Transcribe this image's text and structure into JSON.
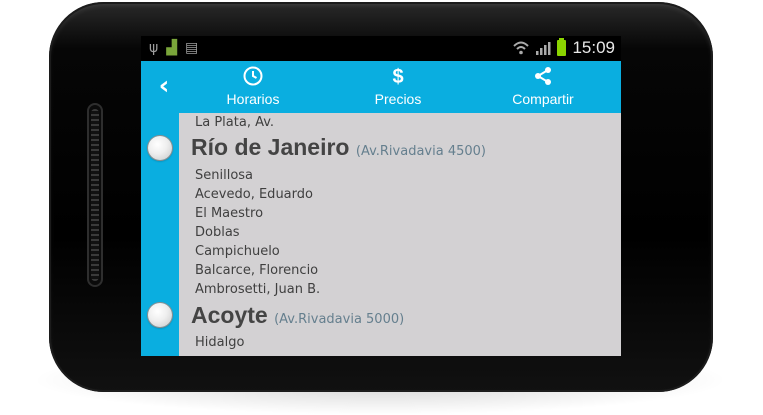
{
  "status_bar": {
    "icons_left": [
      "usb-icon",
      "android-icon",
      "sd-card-icon"
    ],
    "icons_right": [
      "wifi-icon",
      "signal-icon",
      "battery-icon"
    ],
    "time": "15:09",
    "battery_color": "#8bd400"
  },
  "toolbar": {
    "back_icon": "chevron-left-icon",
    "buttons": [
      {
        "label": "Horarios",
        "icon": "clock-icon",
        "glyph": "◷"
      },
      {
        "label": "Precios",
        "icon": "dollar-icon",
        "glyph": "$"
      },
      {
        "label": "Compartir",
        "icon": "share-icon",
        "glyph": "<"
      }
    ],
    "color": "#0aaee0"
  },
  "list": {
    "top_partial_item": "La Plata, Av.",
    "stations": [
      {
        "name": "Río de Janeiro",
        "address": "(Av.Rivadavia 4500)",
        "streets": [
          "Senillosa",
          "Acevedo, Eduardo",
          "El Maestro",
          "Doblas",
          "Campichuelo",
          "Balcarce, Florencio",
          "Ambrosetti, Juan B."
        ]
      },
      {
        "name": "Acoyte",
        "address": "(Av.Rivadavia 5000)",
        "streets": [
          "Hidalgo"
        ]
      }
    ]
  }
}
